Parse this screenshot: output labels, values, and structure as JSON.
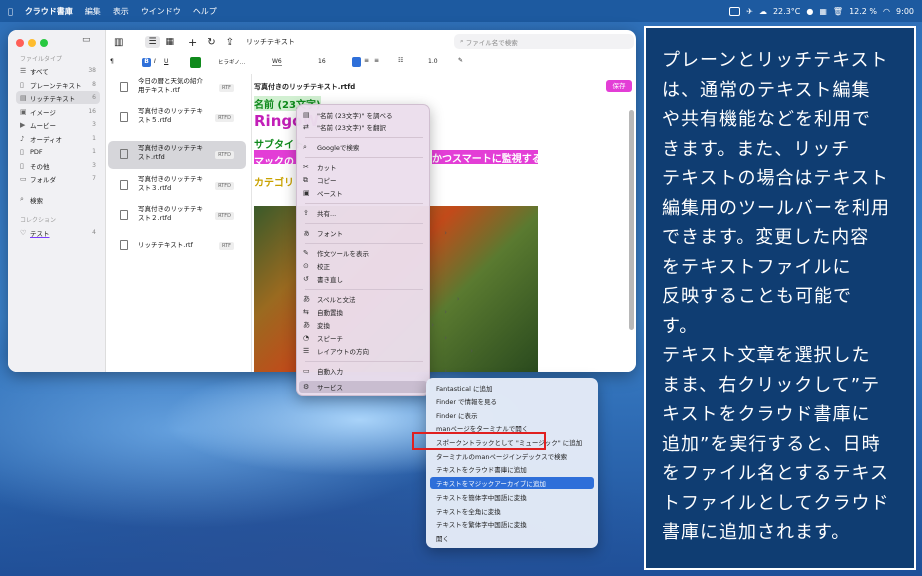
{
  "menubar": {
    "apple_icon": "apple-icon",
    "app": "クラウド書庫",
    "items": [
      "編集",
      "表示",
      "ウインドウ",
      "ヘルプ"
    ],
    "status": {
      "temp": "22.3°C",
      "battery": "12.2 %",
      "time": "9:00"
    }
  },
  "sidebar": {
    "section1": "ファイルタイプ",
    "items": [
      {
        "label": "すべて",
        "count": "38",
        "icon": "all-icon"
      },
      {
        "label": "プレーンテキスト",
        "count": "8",
        "icon": "document-icon"
      },
      {
        "label": "リッチテキスト",
        "count": "6",
        "icon": "rich-text-icon"
      },
      {
        "label": "イメージ",
        "count": "16",
        "icon": "image-icon"
      },
      {
        "label": "ムービー",
        "count": "3",
        "icon": "movie-icon"
      },
      {
        "label": "オーディオ",
        "count": "1",
        "icon": "audio-icon"
      },
      {
        "label": "PDF",
        "count": "1",
        "icon": "pdf-icon"
      },
      {
        "label": "その他",
        "count": "3",
        "icon": "other-icon"
      },
      {
        "label": "フォルダ",
        "count": "7",
        "icon": "folder-icon"
      }
    ],
    "search": "検索",
    "section2": "コレクション",
    "collection": {
      "label": "テスト",
      "count": "4"
    }
  },
  "list": [
    {
      "name": "今日の暦と天気の紹介用テキスト.rtf",
      "tag": "RTF"
    },
    {
      "name": "写真付きのリッチテキスト５.rtfd",
      "tag": "RTFD"
    },
    {
      "name": "写真付きのリッチテキスト.rtfd",
      "tag": "RTFD"
    },
    {
      "name": "写真付きのリッチテキスト３.rtfd",
      "tag": "RTFD"
    },
    {
      "name": "写真付きのリッチテキスト２.rtfd",
      "tag": "RTFD"
    },
    {
      "name": "リッチテキスト.rtf",
      "tag": "RTF"
    }
  ],
  "toolbar": {
    "title": "リッチテキスト",
    "search_placeholder": "ファイル名で検索"
  },
  "format": {
    "paragraph": "¶",
    "font": "ヒラギノ…",
    "weight": "W6",
    "size": "16",
    "spacing": "1.0"
  },
  "editor": {
    "doc_title": "写真付きのリッチテキスト.rtfd",
    "save": "保存",
    "line1": "名前 (23文字)",
    "line2": "RingoW",
    "line3": "サブタイト",
    "line4a": "マックの",
    "line4b": "かつスマートに監視する",
    "line5": "カテゴリ"
  },
  "context_menu": [
    "\"名前 (23文字)\" を調べる",
    "\"名前 (23文字)\" を翻訳",
    "Googleで検索",
    "カット",
    "コピー",
    "ペースト",
    "共有...",
    "フォント",
    "作文ツールを表示",
    "校正",
    "書き直し",
    "スペルと文法",
    "自動置換",
    "変換",
    "スピーチ",
    "レイアウトの方向",
    "自動入力",
    "サービス"
  ],
  "services": [
    "Fantastical に追加",
    "Finder で情報を見る",
    "Finder に表示",
    "manページをターミナルで開く",
    "スポークントラックとして \"ミュージック\" に追加",
    "ターミナルのmanページインデックスで検索",
    "テキストをクラウド書庫に追加",
    "テキストをマジックアーカイブに追加",
    "テキストを簡体字中国語に変換",
    "テキストを全角に変換",
    "テキストを繁体字中国語に変換",
    "開く"
  ],
  "panel": [
    "プレーンとリッチテキスト",
    "は、通常のテキスト編集",
    "や共有機能などを利用で",
    "きます。また、リッチ",
    "テキストの場合はテキスト",
    "編集用のツールバーを利用",
    "できます。変更した内容",
    "をテキストファイルに",
    "反映することも可能で",
    "す。",
    "テキスト文章を選択した",
    "まま、右クリックして”テ",
    "キストをクラウド書庫に",
    "追加”を実行すると、日時",
    "をファイル名とするテキス",
    "トファイルとしてクラウド",
    "書庫に追加されます。"
  ]
}
